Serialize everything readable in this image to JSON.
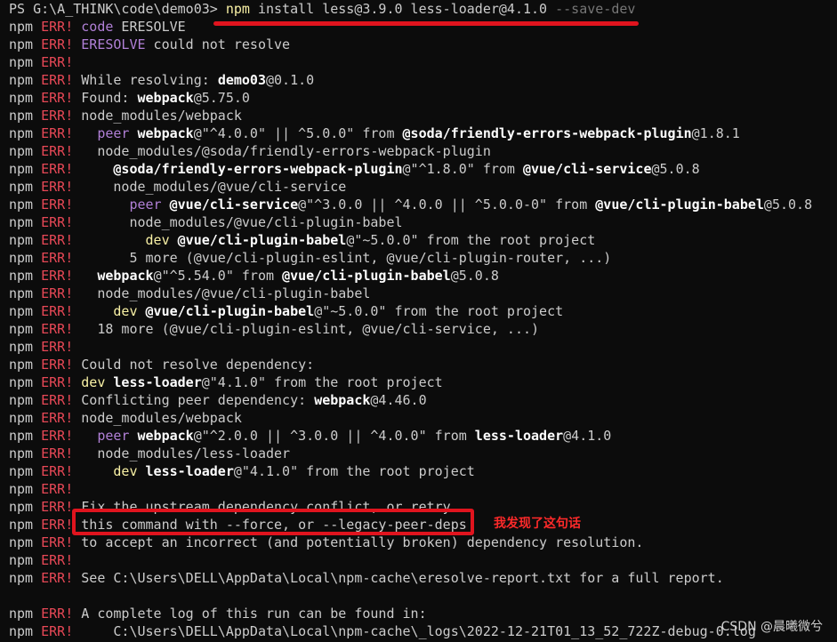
{
  "colors": {
    "background": "#0c0c0c",
    "err": "#e74856",
    "cmd": "#f9f1a5",
    "highlight": "#e0141e"
  },
  "lines": [
    [
      [
        "PS G:\\A_THINK\\code\\demo03> ",
        "w"
      ],
      [
        "npm",
        "y"
      ],
      [
        " install less@3.9.0 less-loader@4.1.0 ",
        "w"
      ],
      [
        "--save-dev",
        "gr"
      ]
    ],
    [
      [
        "npm ",
        "w"
      ],
      [
        "ERR!",
        "r"
      ],
      [
        " ",
        "w"
      ],
      [
        "code",
        "m"
      ],
      [
        " ERESOLVE",
        "w"
      ]
    ],
    [
      [
        "npm ",
        "w"
      ],
      [
        "ERR!",
        "r"
      ],
      [
        " ",
        "w"
      ],
      [
        "ERESOLVE",
        "m"
      ],
      [
        " could not resolve",
        "w"
      ]
    ],
    [
      [
        "npm ",
        "w"
      ],
      [
        "ERR!",
        "r"
      ]
    ],
    [
      [
        "npm ",
        "w"
      ],
      [
        "ERR!",
        "r"
      ],
      [
        " While resolving: ",
        "w"
      ],
      [
        "demo03",
        "b"
      ],
      [
        "@0.1.0",
        "w"
      ]
    ],
    [
      [
        "npm ",
        "w"
      ],
      [
        "ERR!",
        "r"
      ],
      [
        " Found: ",
        "w"
      ],
      [
        "webpack",
        "b"
      ],
      [
        "@5.75.0",
        "w"
      ]
    ],
    [
      [
        "npm ",
        "w"
      ],
      [
        "ERR!",
        "r"
      ],
      [
        " node_modules/webpack",
        "w"
      ]
    ],
    [
      [
        "npm ",
        "w"
      ],
      [
        "ERR!",
        "r"
      ],
      [
        "   ",
        "w"
      ],
      [
        "peer",
        "m"
      ],
      [
        " ",
        "w"
      ],
      [
        "webpack",
        "b"
      ],
      [
        "@\"^4.0.0\" || ^5.0.0\" from ",
        "w"
      ],
      [
        "@soda/friendly-errors-webpack-plugin",
        "b"
      ],
      [
        "@1.8.1",
        "w"
      ]
    ],
    [
      [
        "npm ",
        "w"
      ],
      [
        "ERR!",
        "r"
      ],
      [
        "   node_modules/@soda/friendly-errors-webpack-plugin",
        "w"
      ]
    ],
    [
      [
        "npm ",
        "w"
      ],
      [
        "ERR!",
        "r"
      ],
      [
        "     ",
        "w"
      ],
      [
        "@soda/friendly-errors-webpack-plugin",
        "b"
      ],
      [
        "@\"^1.8.0\" from ",
        "w"
      ],
      [
        "@vue/cli-service",
        "b"
      ],
      [
        "@5.0.8",
        "w"
      ]
    ],
    [
      [
        "npm ",
        "w"
      ],
      [
        "ERR!",
        "r"
      ],
      [
        "     node_modules/@vue/cli-service",
        "w"
      ]
    ],
    [
      [
        "npm ",
        "w"
      ],
      [
        "ERR!",
        "r"
      ],
      [
        "       ",
        "w"
      ],
      [
        "peer",
        "m"
      ],
      [
        " ",
        "w"
      ],
      [
        "@vue/cli-service",
        "b"
      ],
      [
        "@\"^3.0.0 || ^4.0.0 || ^5.0.0-0\" from ",
        "w"
      ],
      [
        "@vue/cli-plugin-babel",
        "b"
      ],
      [
        "@5.0.8",
        "w"
      ]
    ],
    [
      [
        "npm ",
        "w"
      ],
      [
        "ERR!",
        "r"
      ],
      [
        "       node_modules/@vue/cli-plugin-babel",
        "w"
      ]
    ],
    [
      [
        "npm ",
        "w"
      ],
      [
        "ERR!",
        "r"
      ],
      [
        "         ",
        "w"
      ],
      [
        "dev",
        "y"
      ],
      [
        " ",
        "w"
      ],
      [
        "@vue/cli-plugin-babel",
        "b"
      ],
      [
        "@\"~5.0.0\" from the root project",
        "w"
      ]
    ],
    [
      [
        "npm ",
        "w"
      ],
      [
        "ERR!",
        "r"
      ],
      [
        "       5 more (@vue/cli-plugin-eslint, @vue/cli-plugin-router, ...)",
        "w"
      ]
    ],
    [
      [
        "npm ",
        "w"
      ],
      [
        "ERR!",
        "r"
      ],
      [
        "   ",
        "w"
      ],
      [
        "webpack",
        "b"
      ],
      [
        "@\"^5.54.0\" from ",
        "w"
      ],
      [
        "@vue/cli-plugin-babel",
        "b"
      ],
      [
        "@5.0.8",
        "w"
      ]
    ],
    [
      [
        "npm ",
        "w"
      ],
      [
        "ERR!",
        "r"
      ],
      [
        "   node_modules/@vue/cli-plugin-babel",
        "w"
      ]
    ],
    [
      [
        "npm ",
        "w"
      ],
      [
        "ERR!",
        "r"
      ],
      [
        "     ",
        "w"
      ],
      [
        "dev",
        "y"
      ],
      [
        " ",
        "w"
      ],
      [
        "@vue/cli-plugin-babel",
        "b"
      ],
      [
        "@\"~5.0.0\" from the root project",
        "w"
      ]
    ],
    [
      [
        "npm ",
        "w"
      ],
      [
        "ERR!",
        "r"
      ],
      [
        "   18 more (@vue/cli-plugin-eslint, @vue/cli-service, ...)",
        "w"
      ]
    ],
    [
      [
        "npm ",
        "w"
      ],
      [
        "ERR!",
        "r"
      ]
    ],
    [
      [
        "npm ",
        "w"
      ],
      [
        "ERR!",
        "r"
      ],
      [
        " Could not resolve dependency:",
        "w"
      ]
    ],
    [
      [
        "npm ",
        "w"
      ],
      [
        "ERR!",
        "r"
      ],
      [
        " ",
        "w"
      ],
      [
        "dev",
        "y"
      ],
      [
        " ",
        "w"
      ],
      [
        "less-loader",
        "b"
      ],
      [
        "@\"4.1.0\" from the root project",
        "w"
      ]
    ],
    [
      [
        "npm ",
        "w"
      ],
      [
        "ERR!",
        "r"
      ],
      [
        " Conflicting peer dependency: ",
        "w"
      ],
      [
        "webpack",
        "b"
      ],
      [
        "@4.46.0",
        "w"
      ]
    ],
    [
      [
        "npm ",
        "w"
      ],
      [
        "ERR!",
        "r"
      ],
      [
        " node_modules/webpack",
        "w"
      ]
    ],
    [
      [
        "npm ",
        "w"
      ],
      [
        "ERR!",
        "r"
      ],
      [
        "   ",
        "w"
      ],
      [
        "peer",
        "m"
      ],
      [
        " ",
        "w"
      ],
      [
        "webpack",
        "b"
      ],
      [
        "@\"^2.0.0 || ^3.0.0 || ^4.0.0\" from ",
        "w"
      ],
      [
        "less-loader",
        "b"
      ],
      [
        "@4.1.0",
        "w"
      ]
    ],
    [
      [
        "npm ",
        "w"
      ],
      [
        "ERR!",
        "r"
      ],
      [
        "   node_modules/less-loader",
        "w"
      ]
    ],
    [
      [
        "npm ",
        "w"
      ],
      [
        "ERR!",
        "r"
      ],
      [
        "     ",
        "w"
      ],
      [
        "dev",
        "y"
      ],
      [
        " ",
        "w"
      ],
      [
        "less-loader",
        "b"
      ],
      [
        "@\"4.1.0\" from the root project",
        "w"
      ]
    ],
    [
      [
        "npm ",
        "w"
      ],
      [
        "ERR!",
        "r"
      ]
    ],
    [
      [
        "npm ",
        "w"
      ],
      [
        "ERR!",
        "r"
      ],
      [
        " Fix the upstream dependency conflict, or retry",
        "w"
      ]
    ],
    [
      [
        "npm ",
        "w"
      ],
      [
        "ERR!",
        "r"
      ],
      [
        " this command with --force, or --legacy-peer-deps",
        "w"
      ]
    ],
    [
      [
        "npm ",
        "w"
      ],
      [
        "ERR!",
        "r"
      ],
      [
        " to accept an incorrect (and potentially broken) dependency resolution.",
        "w"
      ]
    ],
    [
      [
        "npm ",
        "w"
      ],
      [
        "ERR!",
        "r"
      ]
    ],
    [
      [
        "npm ",
        "w"
      ],
      [
        "ERR!",
        "r"
      ],
      [
        " See C:\\Users\\DELL\\AppData\\Local\\npm-cache\\eresolve-report.txt for a full report.",
        "w"
      ]
    ],
    [],
    [
      [
        "npm ",
        "w"
      ],
      [
        "ERR!",
        "r"
      ],
      [
        " A complete log of this run can be found in:",
        "w"
      ]
    ],
    [
      [
        "npm ",
        "w"
      ],
      [
        "ERR!",
        "r"
      ],
      [
        "     C:\\Users\\DELL\\AppData\\Local\\npm-cache\\_logs\\2022-12-21T01_13_52_722Z-debug-0.log",
        "w"
      ]
    ]
  ],
  "annotation": {
    "note": "我发现了这句话"
  },
  "watermark": "CSDN @晨曦微兮"
}
